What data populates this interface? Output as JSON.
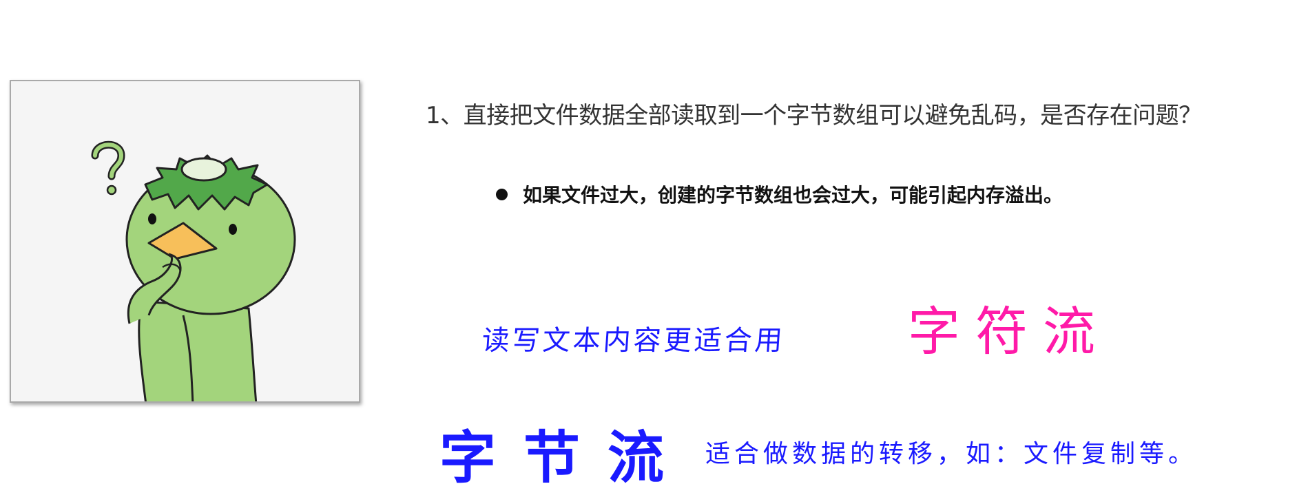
{
  "illustration": {
    "icon": "confused-kappa-character-icon"
  },
  "question": "1、直接把文件数据全部读取到一个字节数组可以避免乱码，是否存在问题？",
  "bullet": "如果文件过大，创建的字节数组也会过大，可能引起内存溢出。",
  "note_top": "读写文本内容更适合用",
  "char_stream": "字符流",
  "byte_stream": "字节流",
  "note_bottom": "适合做数据的转移，如：文件复制等。",
  "colors": {
    "blue": "#1a1aff",
    "pink": "#ff1aa8",
    "kappa_green": "#a3d47c",
    "hair_green": "#52a84a",
    "beak_yellow": "#f7bf5a"
  }
}
